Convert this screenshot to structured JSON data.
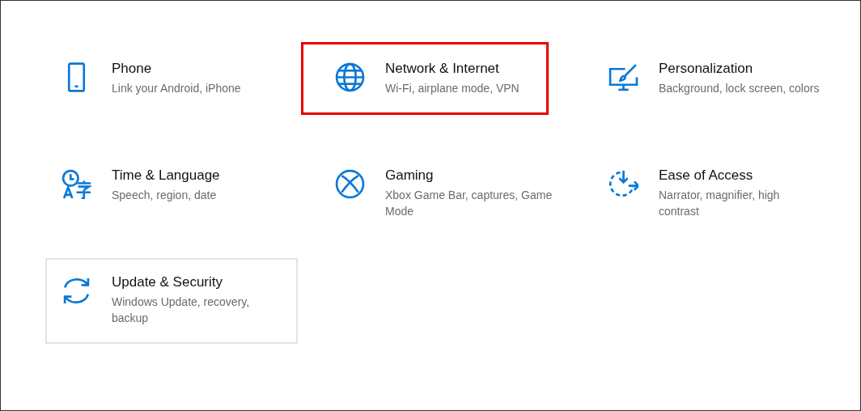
{
  "tiles": [
    {
      "title": "Phone",
      "subtitle": "Link your Android, iPhone",
      "highlighted": false,
      "hovered": false
    },
    {
      "title": "Network & Internet",
      "subtitle": "Wi-Fi, airplane mode, VPN",
      "highlighted": true,
      "hovered": false
    },
    {
      "title": "Personalization",
      "subtitle": "Background, lock screen, colors",
      "highlighted": false,
      "hovered": false
    },
    {
      "title": "Time & Language",
      "subtitle": "Speech, region, date",
      "highlighted": false,
      "hovered": false
    },
    {
      "title": "Gaming",
      "subtitle": "Xbox Game Bar, captures, Game Mode",
      "highlighted": false,
      "hovered": false
    },
    {
      "title": "Ease of Access",
      "subtitle": "Narrator, magnifier, high contrast",
      "highlighted": false,
      "hovered": false
    },
    {
      "title": "Update & Security",
      "subtitle": "Windows Update, recovery, backup",
      "highlighted": false,
      "hovered": true
    }
  ]
}
